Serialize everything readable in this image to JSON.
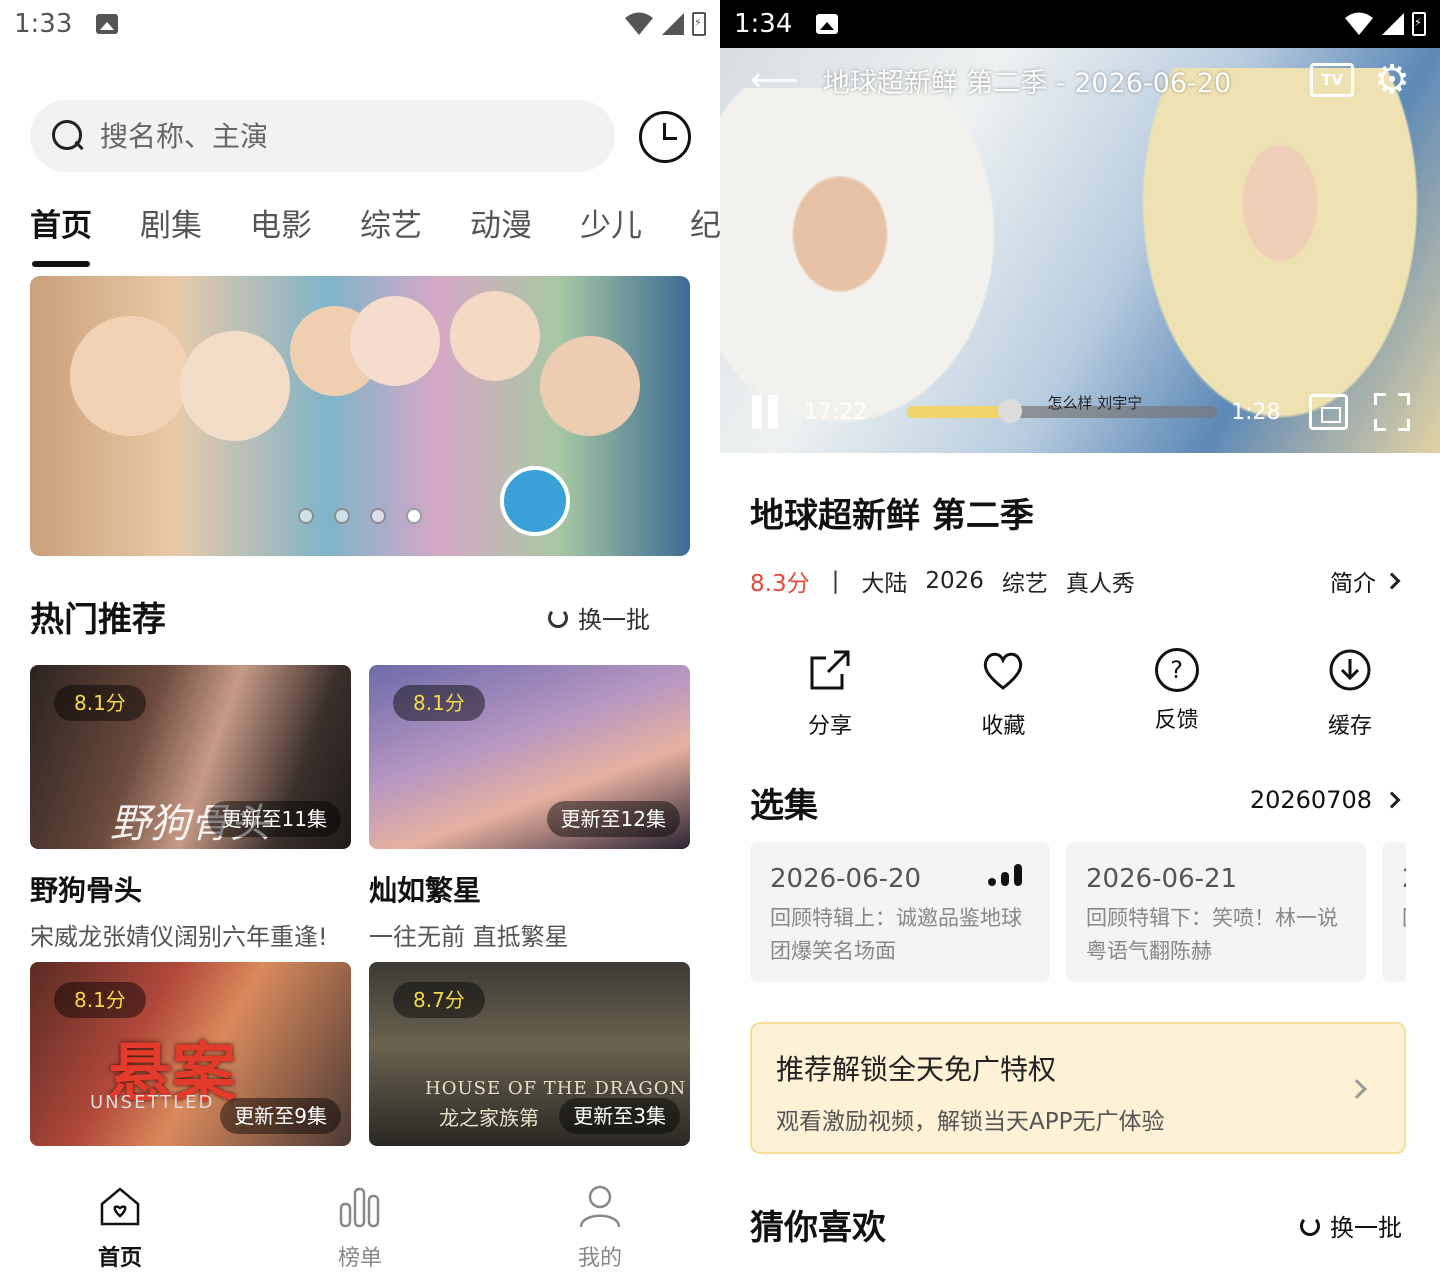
{
  "left": {
    "status": {
      "time": "1:33"
    },
    "search": {
      "placeholder": "搜名称、主演"
    },
    "tabs": [
      "首页",
      "剧集",
      "电影",
      "综艺",
      "动漫",
      "少儿",
      "纪"
    ],
    "banner": {
      "pages": 4,
      "active_index": 3
    },
    "hot": {
      "title": "热门推荐",
      "refresh": "换一批",
      "cards": [
        {
          "rating": "8.1分",
          "update": "更新至11集",
          "name": "野狗骨头",
          "desc": "宋威龙张婧仪阔别六年重逢!",
          "poster_text": "野狗骨头"
        },
        {
          "rating": "8.1分",
          "update": "更新至12集",
          "name": "灿如繁星",
          "desc": "一往无前 直抵繁星"
        },
        {
          "rating": "8.1分",
          "update": "更新至9集",
          "poster_text": "悬案",
          "poster_sub": "UNSETTLED"
        },
        {
          "rating": "8.7分",
          "update": "更新至3集",
          "poster_text": "HOUSE OF THE DRAGON",
          "poster_sub": "龙之家族第"
        }
      ]
    },
    "nav": [
      {
        "label": "首页",
        "icon": "home-icon",
        "active": true
      },
      {
        "label": "榜单",
        "icon": "chart-bars-icon",
        "active": false
      },
      {
        "label": "我的",
        "icon": "person-icon",
        "active": false
      }
    ]
  },
  "right": {
    "status": {
      "time": "1:34"
    },
    "player": {
      "title": "地球超新鲜 第二季 - 2026-06-20",
      "tv_label": "TV",
      "current_time": "17:22",
      "duration": "1:28",
      "progress": 0.33,
      "overlay_caption": "怎么样 刘宇宁"
    },
    "show": {
      "title": "地球超新鲜 第二季",
      "score": "8.3分",
      "separator": "|",
      "tags": [
        "大陆",
        "2026",
        "综艺",
        "真人秀"
      ],
      "intro": "简介"
    },
    "actions": [
      {
        "label": "分享",
        "icon": "share-icon"
      },
      {
        "label": "收藏",
        "icon": "heart-icon"
      },
      {
        "label": "反馈",
        "icon": "question-icon"
      },
      {
        "label": "缓存",
        "icon": "download-icon"
      }
    ],
    "episodes": {
      "title": "选集",
      "code": "20260708",
      "items": [
        {
          "date": "2026-06-20",
          "title": "回顾特辑上：诚邀品鉴地球团爆笑名场面",
          "playing": true
        },
        {
          "date": "2026-06-21",
          "title": "回顾特辑下：笑喷！林一说粤语气翻陈赫",
          "playing": false
        },
        {
          "date": "2",
          "title": "回",
          "playing": false
        }
      ]
    },
    "promo": {
      "title": "推荐解锁全天免广特权",
      "subtitle": "观看激励视频，解锁当天APP无广体验"
    },
    "like": {
      "title": "猜你喜欢",
      "refresh": "换一批"
    }
  }
}
